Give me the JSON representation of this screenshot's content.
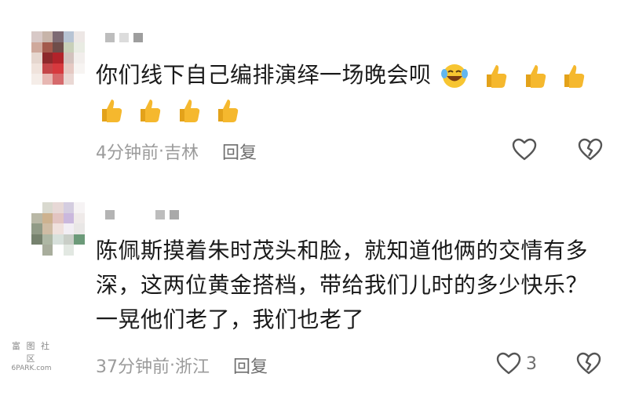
{
  "comments": [
    {
      "text": "你们线下自己编排演绎一场晚会呗",
      "emoji": {
        "laugh": 1,
        "thumbs_line1": 3,
        "thumbs_line2": 4
      },
      "time": "4分钟前",
      "location": "吉林",
      "reply_label": "回复",
      "like_count": ""
    },
    {
      "text": "陈佩斯摸着朱时茂头和脸，就知道他俩的交情有多深，这两位黄金搭档，带给我们儿时的多少快乐？一晃他们老了，我们也老了",
      "time": "37分钟前",
      "location": "浙江",
      "reply_label": "回复",
      "like_count": "3"
    }
  ],
  "separator": " · ",
  "watermark": {
    "top": "富 图 社 区",
    "bottom": "6PARK.com"
  },
  "colors": {
    "text": "#1a1a1a",
    "meta": "#9b9b9b",
    "icon": "#555555",
    "thumb": "#f5b82e"
  },
  "icons": [
    "heart-outline-icon",
    "broken-heart-icon",
    "thumbs-up-emoji",
    "laughing-emoji"
  ]
}
